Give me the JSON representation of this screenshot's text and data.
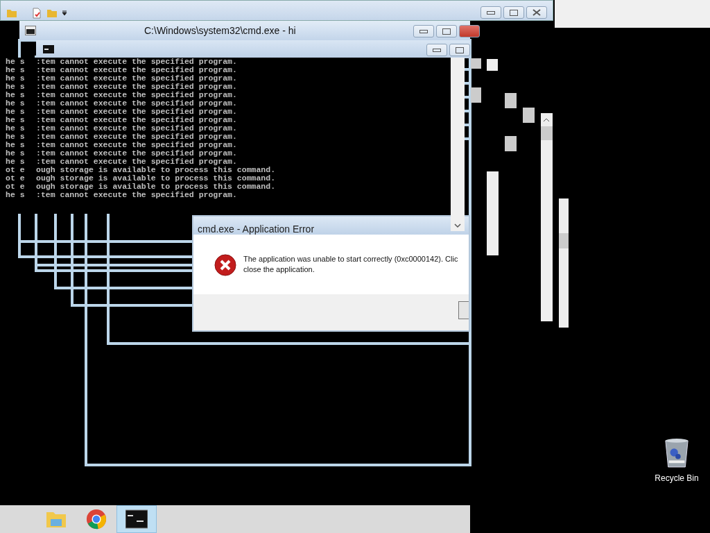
{
  "cmd_window": {
    "title": "C:\\Windows\\system32\\cmd.exe - hi"
  },
  "console": {
    "lines": [
      {
        "left": "he s",
        "right": ":tem cannot execute the specified program."
      },
      {
        "left": "he s",
        "right": ":tem cannot execute the specified program."
      },
      {
        "left": "he s",
        "right": ":tem cannot execute the specified program."
      },
      {
        "left": "he s",
        "right": ":tem cannot execute the specified program."
      },
      {
        "left": "he s",
        "right": ":tem cannot execute the specified program."
      },
      {
        "left": "he s",
        "right": ":tem cannot execute the specified program."
      },
      {
        "left": "he s",
        "right": ":tem cannot execute the specified program."
      },
      {
        "left": "he s",
        "right": ":tem cannot execute the specified program."
      },
      {
        "left": "he s",
        "right": ":tem cannot execute the specified program."
      },
      {
        "left": "he s",
        "right": ":tem cannot execute the specified program."
      },
      {
        "left": "he s",
        "right": ":tem cannot execute the specified program."
      },
      {
        "left": "he s",
        "right": ":tem cannot execute the specified program."
      },
      {
        "left": "he s",
        "right": ":tem cannot execute the specified program."
      },
      {
        "left": "ot e",
        "right": "ough storage is available to process this command."
      },
      {
        "left": "ot e",
        "right": "ough storage is available to process this command."
      },
      {
        "left": "ot e",
        "right": "ough storage is available to process this command."
      },
      {
        "left": "he s",
        "right": ":tem cannot execute the specified program."
      }
    ]
  },
  "error_dialog": {
    "title": "cmd.exe - Application Error",
    "message_lines": [
      "The application was unable to start correctly (0xc0000142). Clic",
      "close the application."
    ]
  },
  "desktop_icons": [
    {
      "label": "Recycle Bin"
    }
  ],
  "taskbar": {
    "items": [
      {
        "kind": "explorer",
        "selected": false
      },
      {
        "kind": "browser",
        "selected": false
      },
      {
        "kind": "console",
        "selected": true
      }
    ]
  }
}
